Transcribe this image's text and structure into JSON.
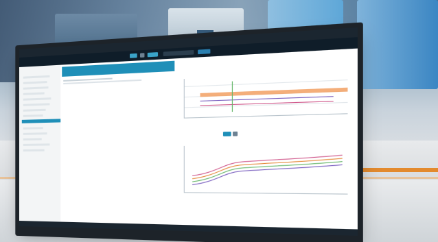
{
  "app": {
    "logo": "",
    "window_title": ""
  },
  "colors": {
    "accent": "#1f8fb8",
    "highlight_band": "#f2a063",
    "dark_bar": "#1b2630"
  },
  "icons": [
    "logo-icon",
    "toolbar-icon",
    "tree-node-icon",
    "chart-icon"
  ],
  "sidebar": {
    "items": [
      "",
      "",
      "",
      "",
      "",
      "",
      "",
      "",
      "",
      "",
      "",
      "",
      "",
      ""
    ]
  }
}
